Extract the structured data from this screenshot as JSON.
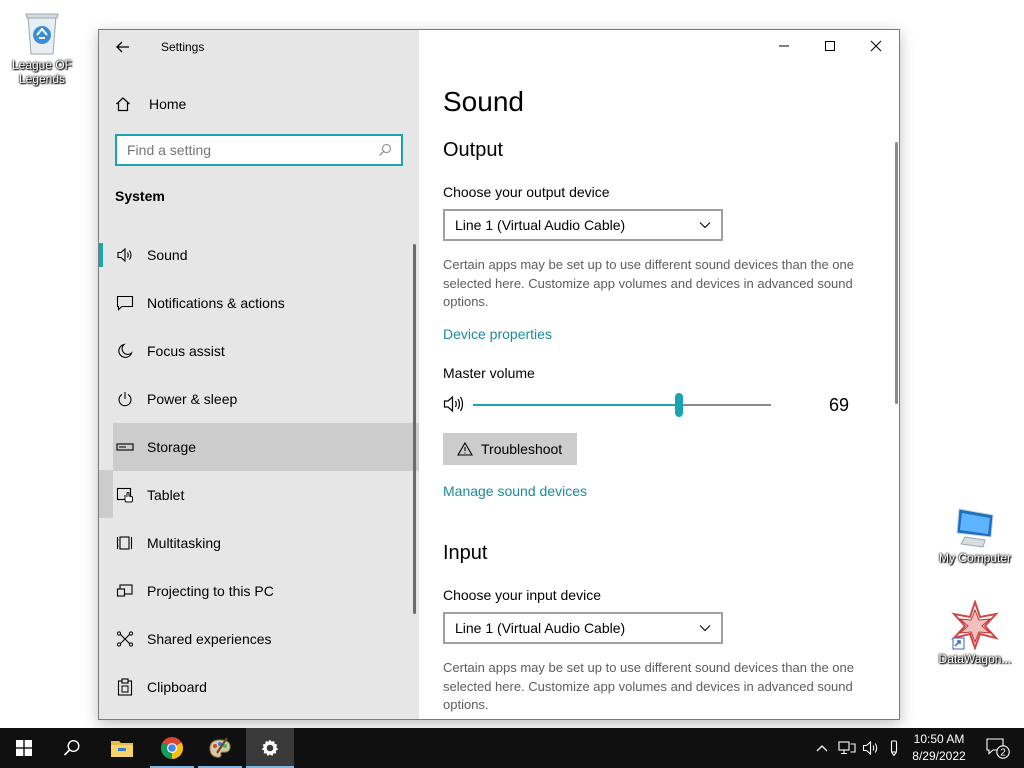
{
  "desktop": {
    "icons": [
      {
        "label": "League OF Legends",
        "icon": "recycle-bin-icon"
      },
      {
        "label": "My Computer",
        "icon": "computer-icon"
      },
      {
        "label": "DataWagon...",
        "icon": "datawagon-app-icon"
      }
    ]
  },
  "window": {
    "title": "Settings",
    "sidebar": {
      "home_label": "Home",
      "search_placeholder": "Find a setting",
      "section_title": "System",
      "items": [
        {
          "label": "Sound",
          "icon": "speaker-icon",
          "state": "selected"
        },
        {
          "label": "Notifications & actions",
          "icon": "notification-icon"
        },
        {
          "label": "Focus assist",
          "icon": "moon-icon"
        },
        {
          "label": "Power & sleep",
          "icon": "power-icon"
        },
        {
          "label": "Storage",
          "icon": "storage-icon",
          "state": "hover"
        },
        {
          "label": "Tablet",
          "icon": "tablet-icon"
        },
        {
          "label": "Multitasking",
          "icon": "multitasking-icon"
        },
        {
          "label": "Projecting to this PC",
          "icon": "projecting-icon"
        },
        {
          "label": "Shared experiences",
          "icon": "shared-experiences-icon"
        },
        {
          "label": "Clipboard",
          "icon": "clipboard-icon"
        }
      ]
    },
    "main": {
      "page_title": "Sound",
      "output": {
        "heading": "Output",
        "device_label": "Choose your output device",
        "device_value": "Line 1 (Virtual Audio Cable)",
        "description": "Certain apps may be set up to use different sound devices than the one selected here. Customize app volumes and devices in advanced sound options.",
        "device_properties_link": "Device properties",
        "master_volume_label": "Master volume",
        "volume": 69,
        "volume_text": "69",
        "troubleshoot_label": "Troubleshoot",
        "manage_link": "Manage sound devices"
      },
      "input": {
        "heading": "Input",
        "device_label": "Choose your input device",
        "device_value": "Line 1 (Virtual Audio Cable)",
        "description": "Certain apps may be set up to use different sound devices than the one selected here. Customize app volumes and devices in advanced sound options."
      }
    }
  },
  "taskbar": {
    "apps": [
      "start-icon",
      "search-icon",
      "file-explorer-icon",
      "chrome-icon",
      "paint-icon",
      "settings-icon"
    ],
    "time": "10:50 AM",
    "date": "8/29/2022",
    "notification_count": "2"
  },
  "colors": {
    "accent": "#1aa3b2",
    "link": "#1b8a9a",
    "sidebar_bg": "#e6e6e6",
    "taskbar_bg": "#101010"
  }
}
